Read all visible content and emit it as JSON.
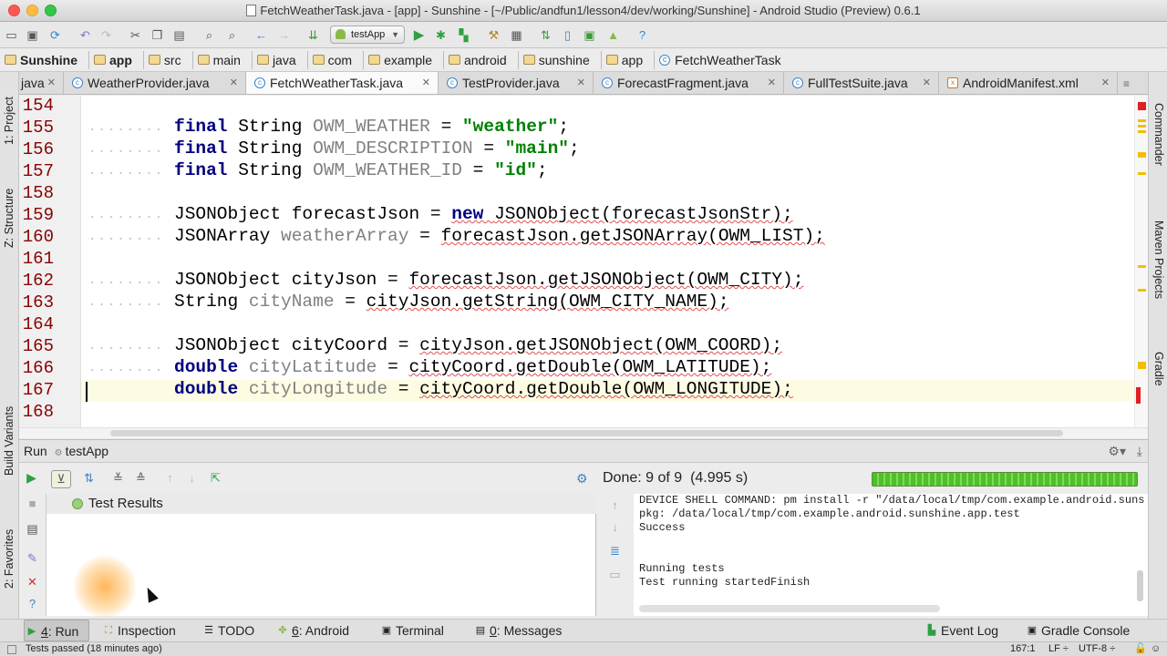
{
  "window": {
    "title": "FetchWeatherTask.java - [app] - Sunshine - [~/Public/andfun1/lesson4/dev/working/Sunshine] - Android Studio (Preview) 0.6.1"
  },
  "toolbar": {
    "run_config": "testApp"
  },
  "breadcrumbs": [
    "Sunshine",
    "app",
    "src",
    "main",
    "java",
    "com",
    "example",
    "android",
    "sunshine",
    "app",
    "FetchWeatherTask"
  ],
  "tabs": [
    {
      "label": "java"
    },
    {
      "label": "WeatherProvider.java"
    },
    {
      "label": "FetchWeatherTask.java",
      "active": true
    },
    {
      "label": "TestProvider.java"
    },
    {
      "label": "ForecastFragment.java"
    },
    {
      "label": "FullTestSuite.java"
    },
    {
      "label": "AndroidManifest.xml"
    }
  ],
  "left_tools": [
    "1: Project",
    "Z: Structure",
    "Build Variants",
    "2: Favorites"
  ],
  "right_tools": [
    "Commander",
    "Maven Projects",
    "Gradle"
  ],
  "editor": {
    "line_numbers": [
      "154",
      "155",
      "156",
      "157",
      "158",
      "159",
      "160",
      "161",
      "162",
      "163",
      "164",
      "165",
      "166",
      "167",
      "168"
    ],
    "code": {
      "l155": {
        "kw": "final",
        "type": "String",
        "var": "OWM_WEATHER",
        "eq": "=",
        "str": "\"weather\"",
        "end": ";"
      },
      "l156": {
        "kw": "final",
        "type": "String",
        "var": "OWM_DESCRIPTION",
        "eq": "=",
        "str": "\"main\"",
        "end": ";"
      },
      "l157": {
        "kw": "final",
        "type": "String",
        "var": "OWM_WEATHER_ID",
        "eq": "=",
        "str": "\"id\"",
        "end": ";"
      },
      "l159": {
        "pre": "JSONObject forecastJson = ",
        "kw": "new",
        "call": "JSONObject(forecastJsonStr);"
      },
      "l160": {
        "type": "JSONArray",
        "var": "weatherArray",
        "eq": "=",
        "call": "forecastJson.getJSONArray(OWM_LIST);"
      },
      "l162": {
        "pre": "JSONObject cityJson = ",
        "call": "forecastJson.getJSONObject(OWM_CITY);"
      },
      "l163": {
        "type": "String",
        "var": "cityName",
        "eq": "=",
        "call": "cityJson.getString(OWM_CITY_NAME);"
      },
      "l165": {
        "pre": "JSONObject cityCoord = ",
        "call": "cityJson.getJSONObject(OWM_COORD);"
      },
      "l166": {
        "kw": "double",
        "var": "cityLatitude",
        "eq": "=",
        "call": "cityCoord.getDouble(OWM_LATITUDE);"
      },
      "l167": {
        "kw": "double",
        "var": "cityLongitude",
        "eq": "=",
        "call": "cityCoord.getDouble(OWM_LONGITUDE);"
      }
    }
  },
  "run_panel": {
    "label": "Run",
    "config": "testApp",
    "status": "Done: 9 of 9",
    "duration": "(4.995 s)",
    "progress": 1.0,
    "results_root": "Test Results",
    "console_lines": [
      "DEVICE SHELL COMMAND: pm install -r \"/data/local/tmp/com.example.android.suns",
      "pkg: /data/local/tmp/com.example.android.sunshine.app.test",
      "Success",
      "",
      "",
      "Running tests",
      "Test running startedFinish"
    ]
  },
  "tool_windows": {
    "run": {
      "mnemonic": "4",
      "label": ": Run"
    },
    "inspection": "Inspection",
    "todo": "TODO",
    "android": {
      "mnemonic": "6",
      "label": ": Android"
    },
    "terminal": "Terminal",
    "messages": {
      "mnemonic": "0",
      "label": ": Messages"
    },
    "event_log": "Event Log",
    "gradle_console": "Gradle Console"
  },
  "status_bar": {
    "message": "Tests passed (18 minutes ago)",
    "position": "167:1",
    "line_sep": "LF",
    "encoding": "UTF-8"
  },
  "colors": {
    "keyword": "#000080",
    "string": "#008000",
    "unused": "#808080",
    "line_number": "#8a0000",
    "progress": "#4fbf2a"
  }
}
